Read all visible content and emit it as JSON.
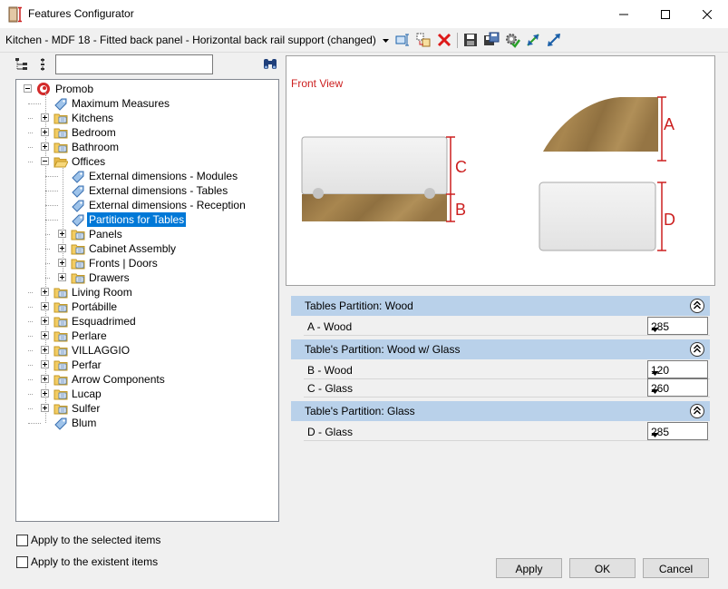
{
  "window": {
    "title": "Features Configurator"
  },
  "toolbar": {
    "config_title": "Kitchen - MDF 18 - Fitted back panel - Horizontal back rail support (changed)"
  },
  "search": {
    "value": "",
    "placeholder": ""
  },
  "tree": {
    "root": "Promob",
    "items": [
      "Maximum Measures",
      "Kitchens",
      "Bedroom",
      "Bathroom",
      "Offices",
      "External dimensions - Modules",
      "External dimensions - Tables",
      "External dimensions - Reception",
      "Partitions for Tables",
      "Panels",
      "Cabinet Assembly",
      "Fronts | Doors",
      "Drawers",
      "Living Room",
      "Portábille",
      "Esquadrimed",
      "Perlare",
      "VILLAGGIO",
      "Perfar",
      "Arrow Components",
      "Lucap",
      "Sulfer",
      "Blum"
    ]
  },
  "preview": {
    "label": "Front View",
    "dim_a": "A",
    "dim_b": "B",
    "dim_c": "C",
    "dim_d": "D",
    "accent_color": "#cc1f1f"
  },
  "properties": {
    "categories": [
      {
        "title": "Tables Partition: Wood",
        "rows": [
          {
            "label": "A - Wood",
            "value": "285"
          }
        ]
      },
      {
        "title": "Table's Partition: Wood w/ Glass",
        "rows": [
          {
            "label": "B - Wood",
            "value": "120"
          },
          {
            "label": "C - Glass",
            "value": "260"
          }
        ]
      },
      {
        "title": "Table's Partition: Glass",
        "rows": [
          {
            "label": "D - Glass",
            "value": "285"
          }
        ]
      }
    ]
  },
  "options": {
    "apply_selected": "Apply to the selected items",
    "apply_existent": "Apply to the existent items"
  },
  "buttons": {
    "apply": "Apply",
    "ok": "OK",
    "cancel": "Cancel"
  }
}
